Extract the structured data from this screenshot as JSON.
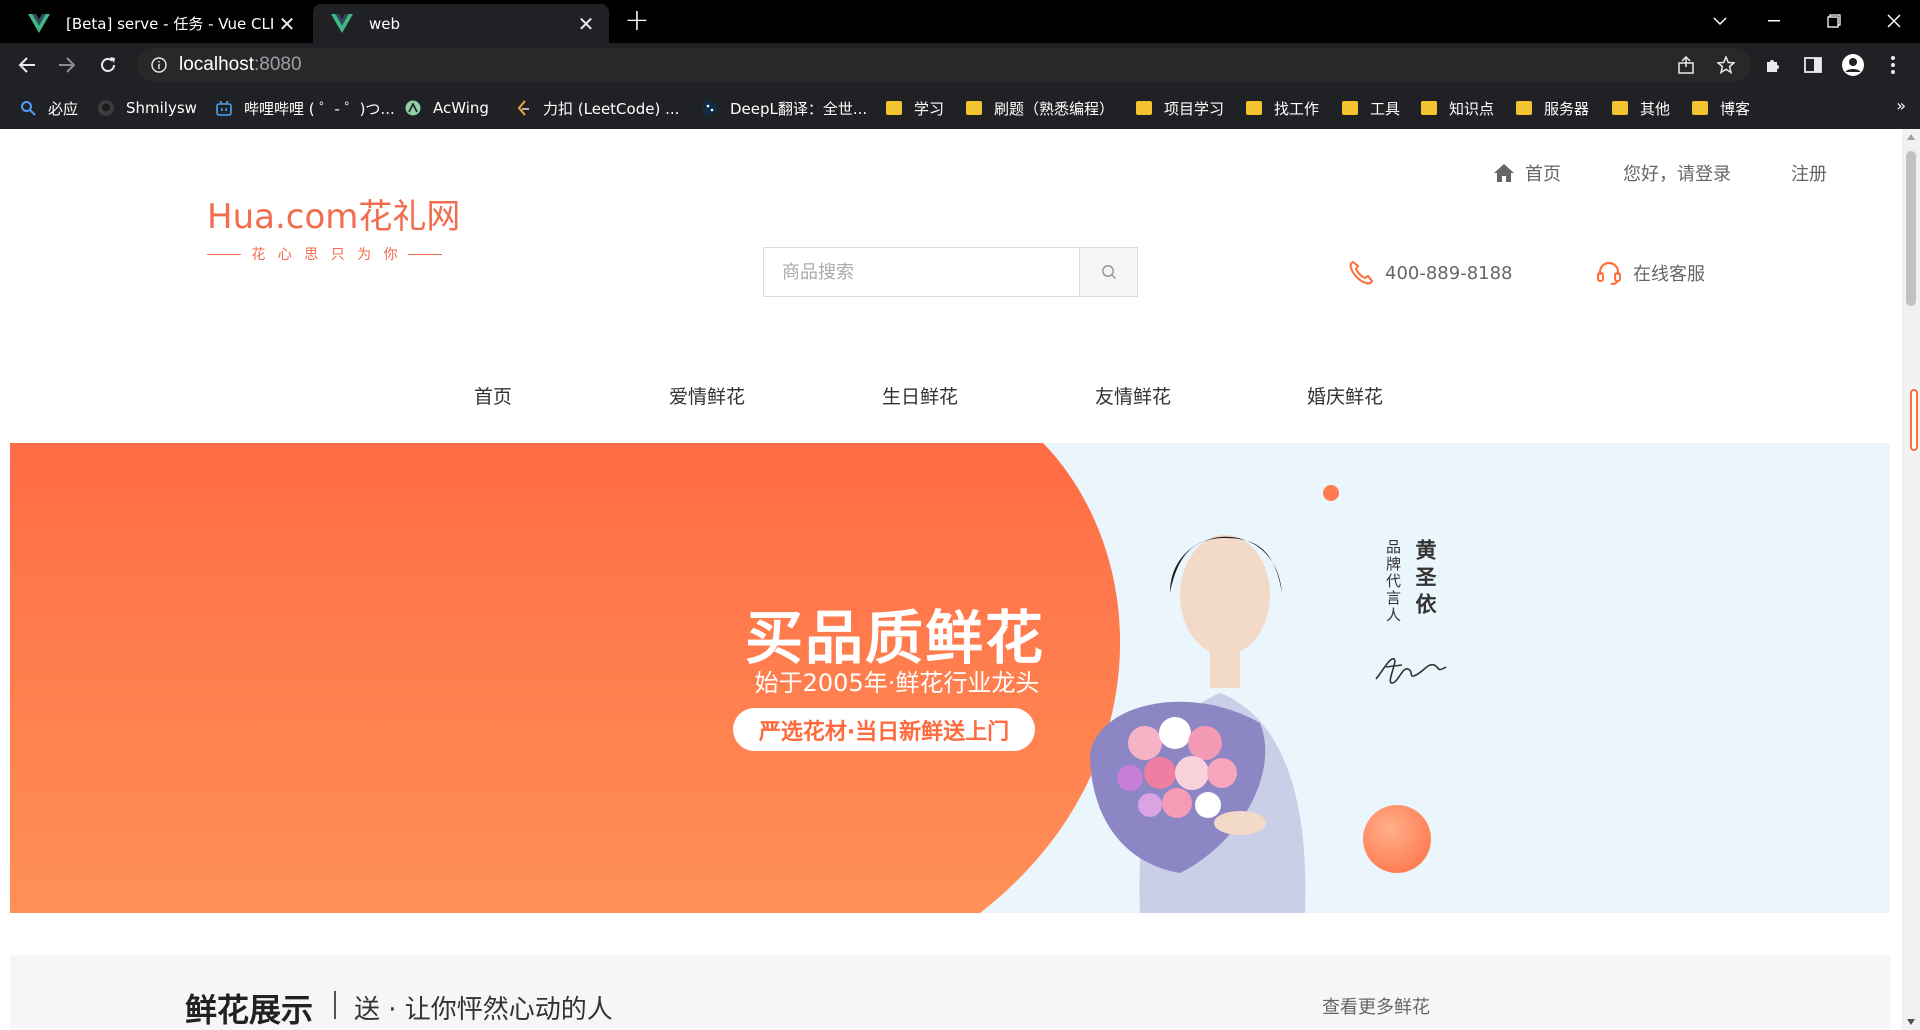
{
  "browser": {
    "tabs": [
      {
        "title": "[Beta] serve - 任务 - Vue CLI",
        "active": false
      },
      {
        "title": "web",
        "active": true
      }
    ],
    "new_tab": "+",
    "url_host": "localhost",
    "url_port": ":8080",
    "bookmarks": [
      {
        "label": "必应",
        "icon": "bing-icon"
      },
      {
        "label": "Shmilysw",
        "icon": "github-icon"
      },
      {
        "label": "哔哩哔哩 ( ゜- ゜)つ...",
        "icon": "bilibili-icon"
      },
      {
        "label": "AcWing",
        "icon": "acwing-icon"
      },
      {
        "label": "力扣 (LeetCode) ...",
        "icon": "leetcode-icon"
      },
      {
        "label": "DeepL翻译：全世...",
        "icon": "deepl-icon"
      },
      {
        "label": "学习",
        "icon": "folder-icon"
      },
      {
        "label": "刷题（熟悉编程）",
        "icon": "folder-icon"
      },
      {
        "label": "项目学习",
        "icon": "folder-icon"
      },
      {
        "label": "找工作",
        "icon": "folder-icon"
      },
      {
        "label": "工具",
        "icon": "folder-icon"
      },
      {
        "label": "知识点",
        "icon": "folder-icon"
      },
      {
        "label": "服务器",
        "icon": "folder-icon"
      },
      {
        "label": "其他",
        "icon": "folder-icon"
      },
      {
        "label": "博客",
        "icon": "folder-icon"
      }
    ],
    "bookmarks_more": "»"
  },
  "topbar": {
    "home": "首页",
    "login": "您好，请登录",
    "register": "注册"
  },
  "logo": {
    "name": "Hua.com花礼网",
    "slogan": "花 心 思  只 为 你"
  },
  "search": {
    "placeholder": "商品搜索"
  },
  "contact": {
    "phone": "400-889-8188",
    "service": "在线客服"
  },
  "categories": [
    "首页",
    "爱情鲜花",
    "生日鲜花",
    "友情鲜花",
    "婚庆鲜花"
  ],
  "banner": {
    "headline": "买品质鲜花",
    "subline": "始于2005年·鲜花行业龙头",
    "pill": "严选花材·当日新鲜送上门",
    "ambassador_name": "黄圣依",
    "ambassador_title": "品牌代言人"
  },
  "showcase": {
    "title": "鲜花展示",
    "subtitle": "送 · 让你怦然心动的人",
    "more": "查看更多鲜花"
  },
  "colors": {
    "brand_orange": "#ff6f3c",
    "banner_bg": "#eaf5fc",
    "chrome_dark": "#202124"
  }
}
